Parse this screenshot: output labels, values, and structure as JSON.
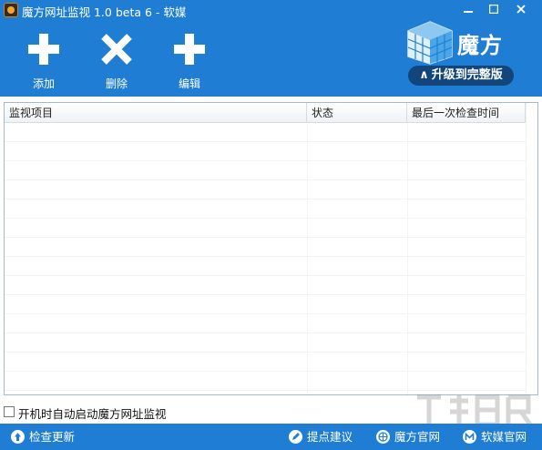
{
  "window": {
    "title": "魔方网址监视 1.0 beta 6 - 软媒",
    "minimize_icon": "minimize-icon",
    "maximize_icon": "maximize-icon",
    "close_icon": "close-icon"
  },
  "toolbar": {
    "add_label": "添加",
    "delete_label": "删除",
    "edit_label": "编辑"
  },
  "brand": {
    "name": "魔方",
    "upgrade_label": "升级到完整版"
  },
  "table": {
    "columns": [
      "监视项目",
      "状态",
      "最后一次检查时间"
    ],
    "rows": []
  },
  "options": {
    "autostart_label": "开机时自动启动魔方网址监视",
    "autostart_checked": false
  },
  "statusbar": {
    "check_update": "检查更新",
    "suggestion": "提点建议",
    "mofang_site": "魔方官网",
    "ruanmei_site": "软媒官网"
  },
  "colors": {
    "accent": "#1f7ed3",
    "upgrade_bg": "#12457c"
  }
}
